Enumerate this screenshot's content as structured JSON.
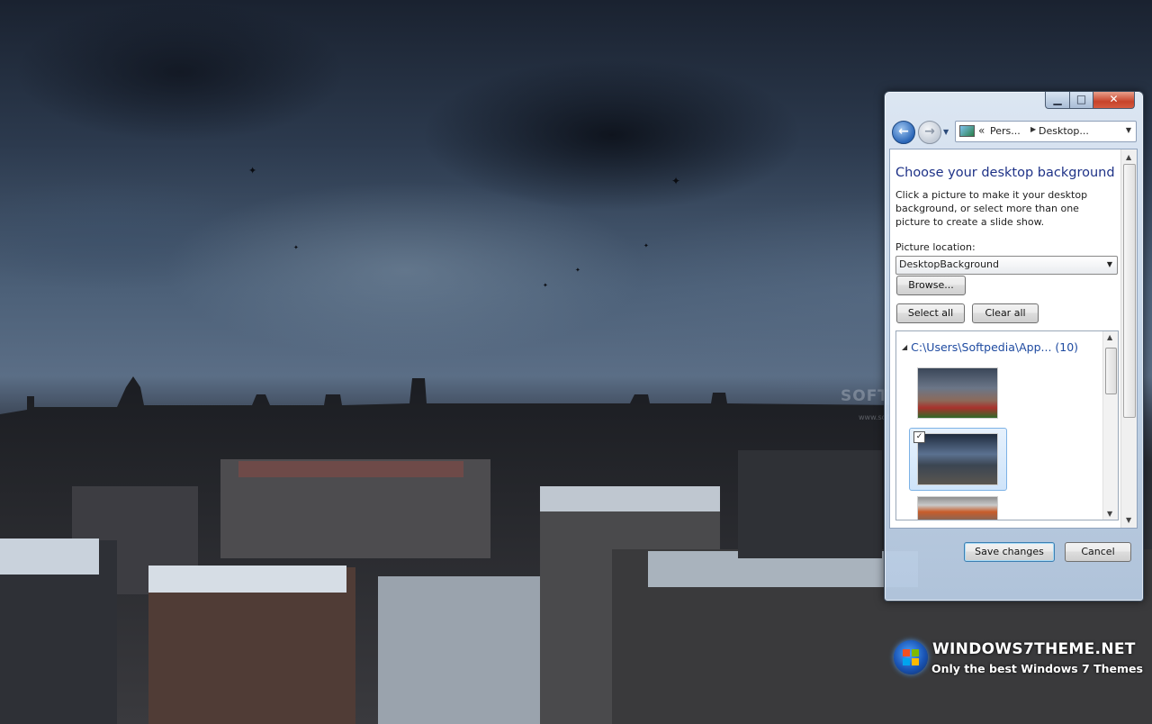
{
  "window": {
    "controls": {
      "minimize": "▁",
      "maximize": "□",
      "close": "✕"
    },
    "address_bar": {
      "overflow": "«",
      "crumbs": [
        "Pers...",
        "Desktop..."
      ]
    },
    "title": "Choose your desktop background",
    "description": "Click a picture to make it your desktop background, or select more than one picture to create a slide show.",
    "picture_location": {
      "label": "Picture location:",
      "value": "DesktopBackground"
    },
    "buttons": {
      "browse": "Browse...",
      "select_all": "Select all",
      "clear_all": "Clear all",
      "save": "Save changes",
      "cancel": "Cancel"
    },
    "gallery": {
      "group_header": "C:\\Users\\Softpedia\\App... (10)",
      "thumbnails": [
        {
          "checked": false
        },
        {
          "checked": true,
          "check_mark": "✓"
        },
        {
          "checked": false
        }
      ]
    }
  },
  "watermarks": {
    "softpedia": "SOFTPEDIA",
    "softpedia_sub": "www.softpedia.com",
    "site_title": "WINDOWS7THEME.NET",
    "site_tagline": "Only the best Windows 7 Themes"
  },
  "colors": {
    "title_blue": "#1e3287",
    "link_blue": "#1e4aa0",
    "close_red": "#c7432a",
    "sky_dark": "#1a2230"
  }
}
